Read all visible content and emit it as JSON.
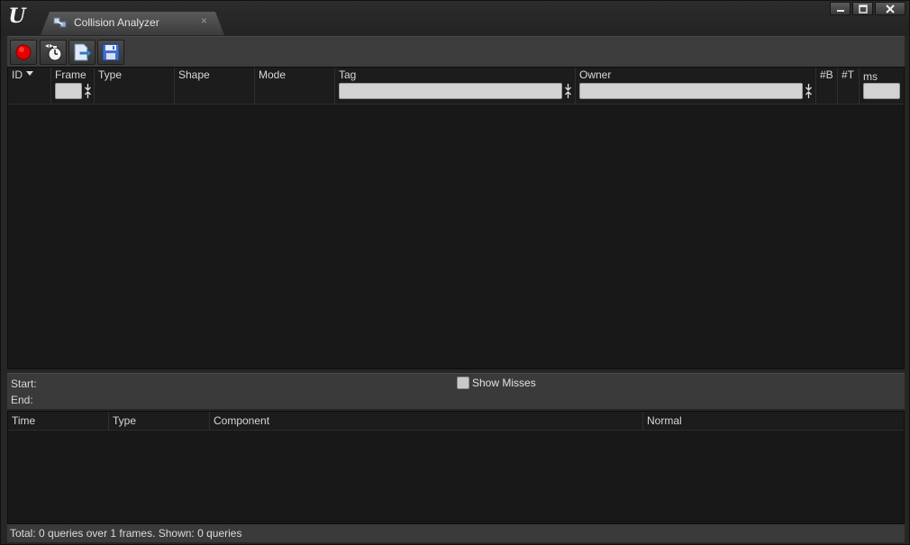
{
  "window": {
    "tab_title": "Collision Analyzer",
    "tab_close_glyph": "×",
    "icons": {
      "app_logo": "unreal-logo-icon",
      "tab_icon": "collision-analyzer-icon",
      "minimize": "minimize-icon",
      "maximize": "maximize-icon",
      "close": "close-icon"
    }
  },
  "toolbar": {
    "buttons": [
      {
        "icon": "record-icon",
        "color": "#e60000"
      },
      {
        "icon": "timer-icon"
      },
      {
        "icon": "load-file-icon"
      },
      {
        "icon": "save-icon"
      }
    ]
  },
  "query_table": {
    "columns": [
      "ID",
      "Frame",
      "Type",
      "Shape",
      "Mode",
      "Tag",
      "Owner",
      "#B",
      "#T",
      "ms"
    ],
    "sorted_by": "ID",
    "sort_direction": "descending",
    "filters": {
      "frame": {
        "value": "",
        "placeholder": ""
      },
      "tag": {
        "value": "",
        "placeholder": ""
      },
      "owner": {
        "value": "",
        "placeholder": ""
      },
      "ms": {
        "value": "",
        "placeholder": ""
      }
    },
    "rows": []
  },
  "details": {
    "start_label": "Start:",
    "end_label": "End:",
    "show_misses_label": "Show Misses",
    "show_misses_checked": false
  },
  "hits_table": {
    "columns": [
      "Time",
      "Type",
      "Component",
      "Normal"
    ],
    "rows": []
  },
  "status": {
    "text": "Total: 0 queries over 1 frames. Shown: 0 queries"
  }
}
